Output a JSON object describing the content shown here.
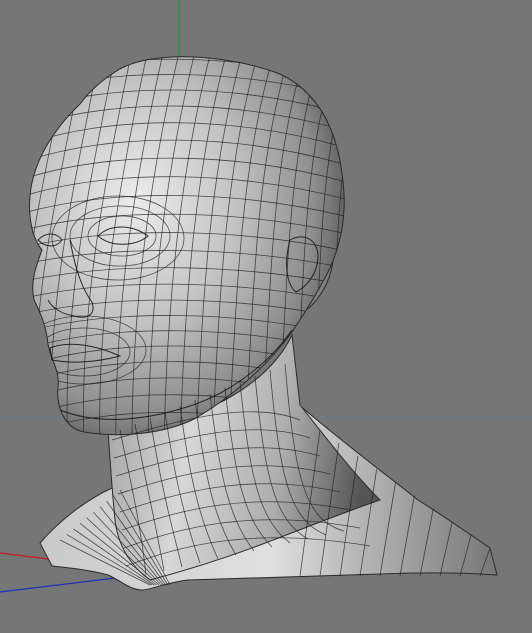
{
  "viewport": {
    "view": "perspective",
    "background_color": "#767676",
    "object": "head-mesh",
    "display_mode": "gouraud-shading-lines"
  },
  "axes": {
    "x_color": "#c21d1d",
    "y_color": "#14a314",
    "z_color": "#1e2fb4",
    "horizon_color": "#5f7ea6"
  },
  "mesh": {
    "fill_light": "#d9d9d9",
    "fill_mid": "#9d9d9d",
    "fill_dark": "#3e3e3e",
    "wire_color": "#1d1d1d"
  }
}
